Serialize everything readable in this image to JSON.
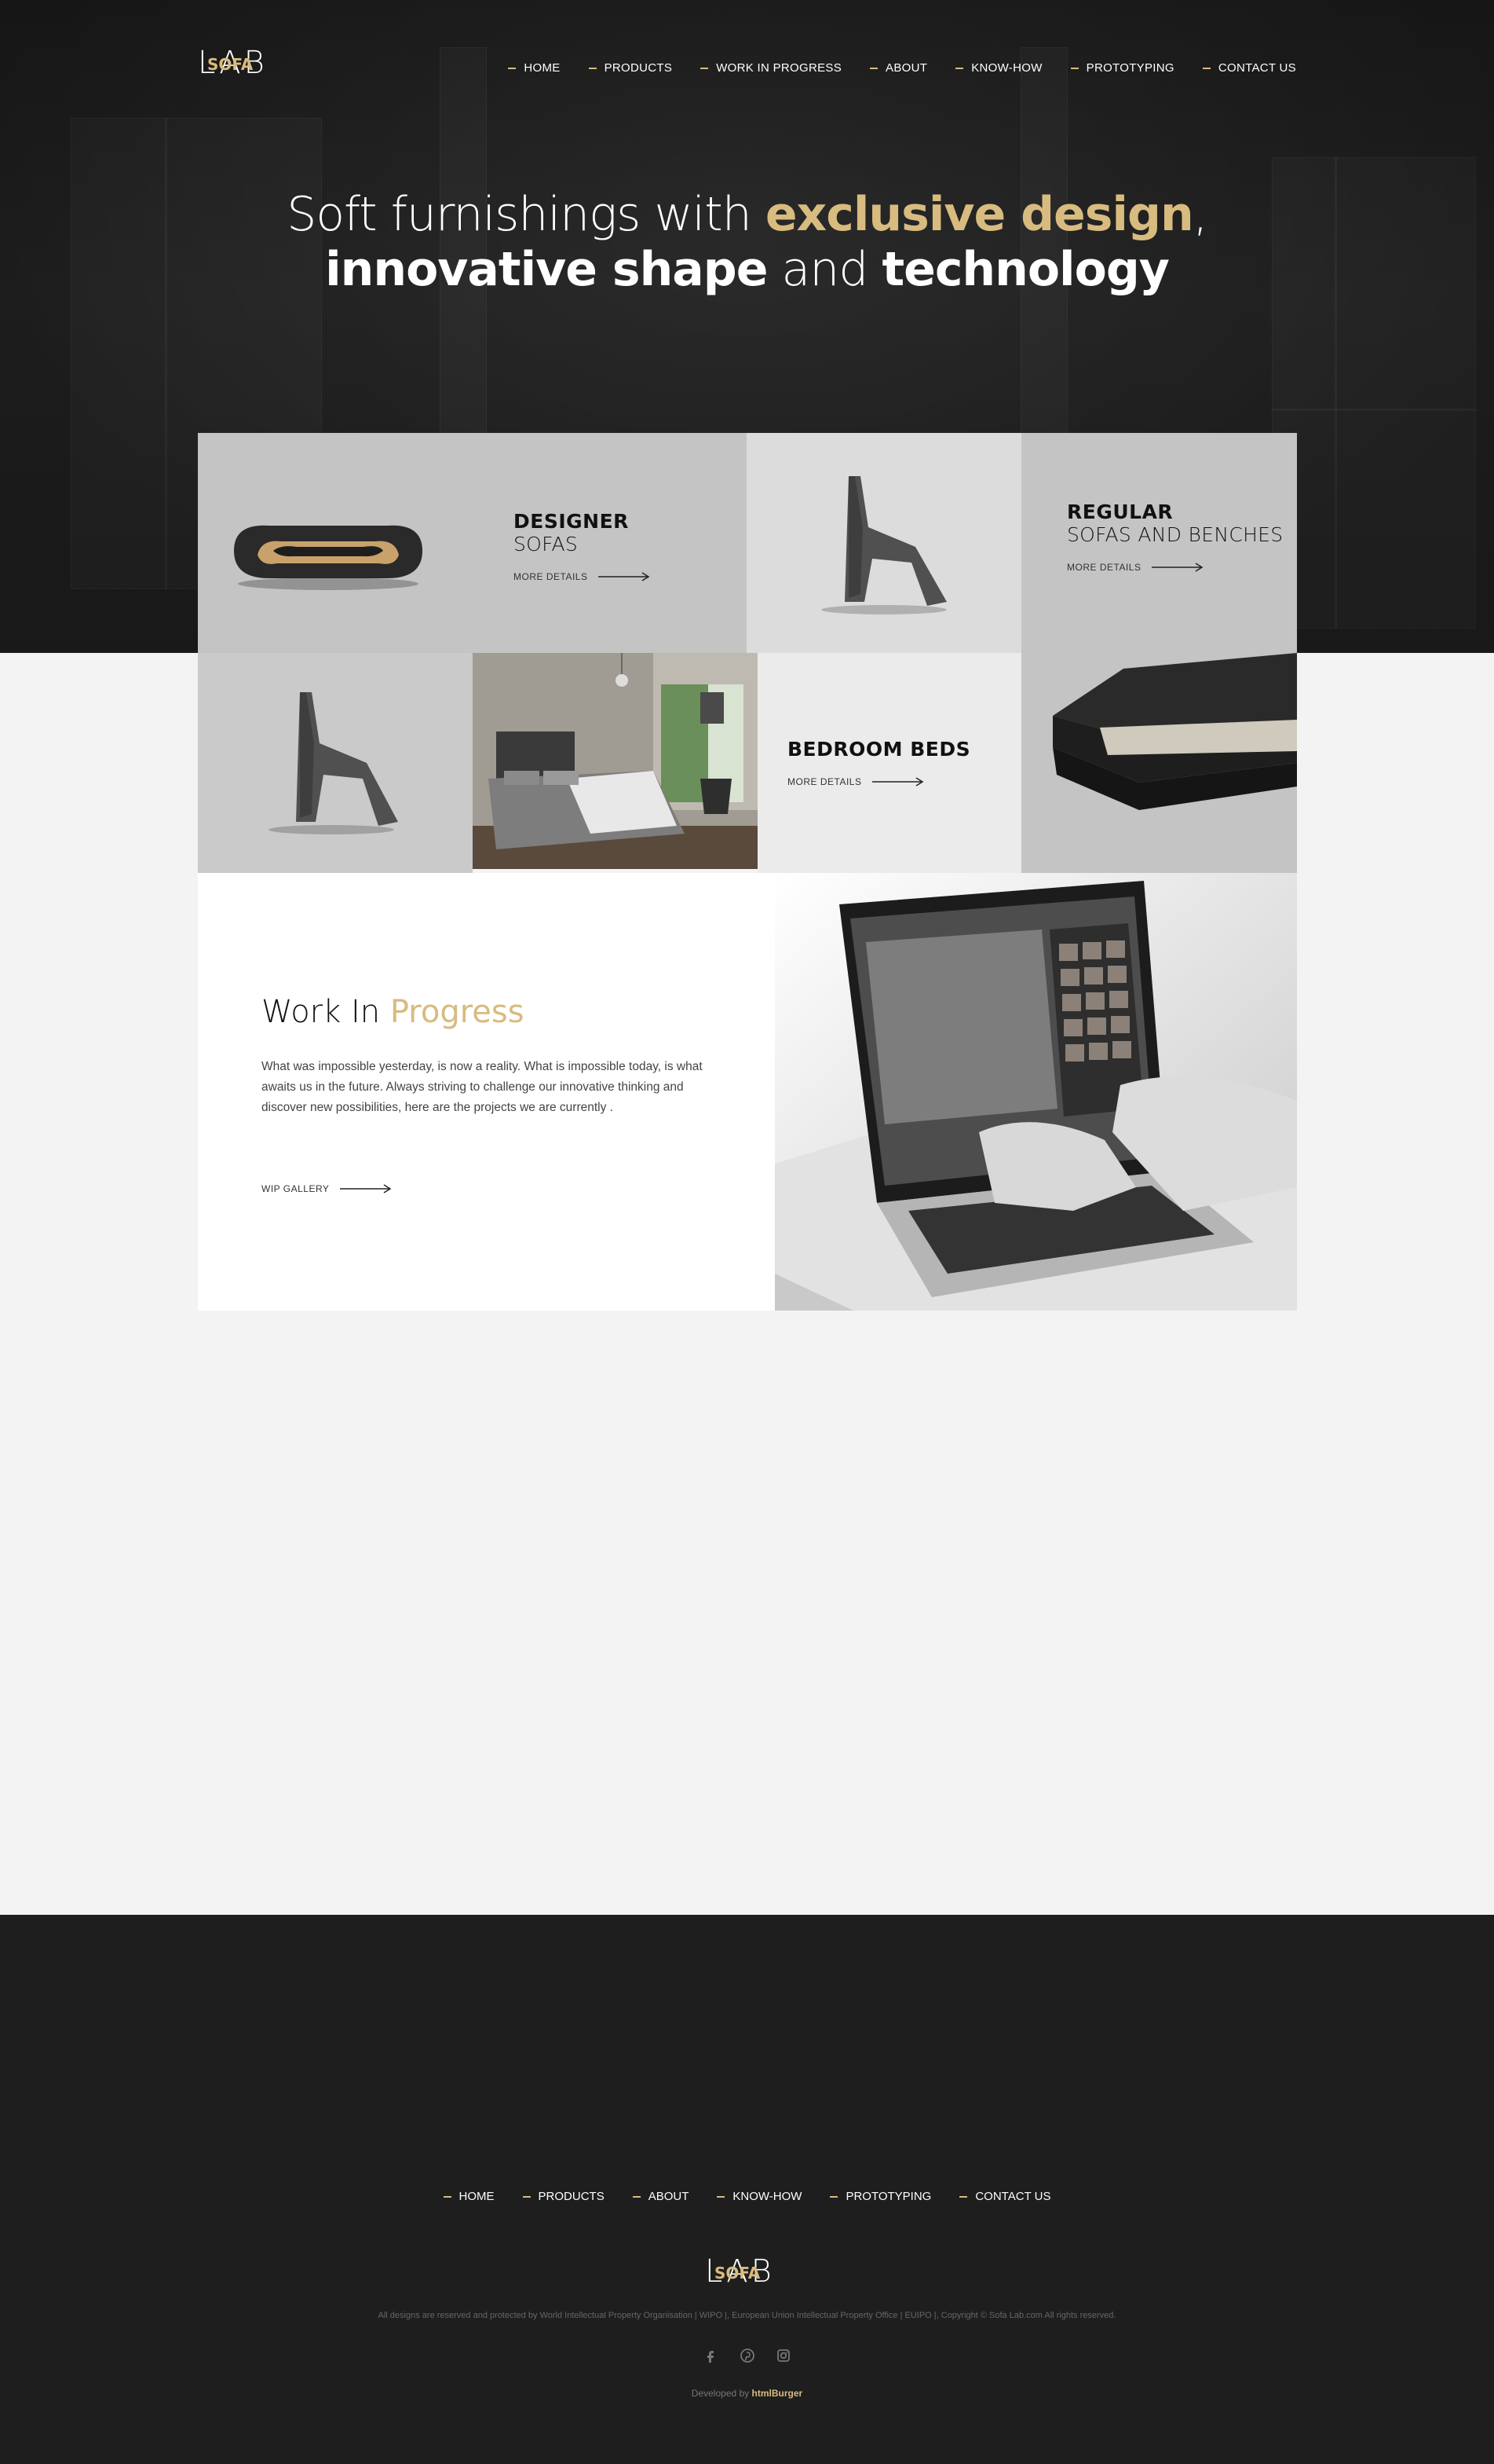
{
  "brand": {
    "logo_main": "LAB",
    "logo_accent": "SOFA"
  },
  "nav": {
    "items": [
      {
        "label": "HOME"
      },
      {
        "label": "PRODUCTS"
      },
      {
        "label": "WORK IN PROGRESS"
      },
      {
        "label": "ABOUT"
      },
      {
        "label": "KNOW-HOW"
      },
      {
        "label": "PROTOTYPING"
      },
      {
        "label": "CONTACT US"
      }
    ]
  },
  "hero": {
    "line1_a": "Soft furnishings with ",
    "line1_gold": "exclusive design",
    "line1_b": ",",
    "line2_a": "innovative shape",
    "line2_b": " and ",
    "line2_c": "technology"
  },
  "tiles": {
    "designer": {
      "title": "DESIGNER",
      "subtitle": "SOFAS",
      "link": "MORE DETAILS"
    },
    "regular": {
      "title": "REGULAR",
      "subtitle": "SOFAS AND BENCHES",
      "link": "MORE DETAILS"
    },
    "bedroom": {
      "title": "BEDROOM BEDS",
      "link": "MORE DETAILS"
    }
  },
  "wip": {
    "title_a": "Work In ",
    "title_gold": "Progress",
    "text": "What was impossible yesterday, is now a reality. What is impossible today, is what awaits us in the future. Always striving to challenge our innovative thinking and discover new possibilities, here are the projects we are currently .",
    "link": "WIP GALLERY"
  },
  "footer": {
    "nav": [
      {
        "label": "HOME"
      },
      {
        "label": "PRODUCTS"
      },
      {
        "label": "ABOUT"
      },
      {
        "label": "KNOW-HOW"
      },
      {
        "label": "PROTOTYPING"
      },
      {
        "label": "CONTACT US"
      }
    ],
    "legal": "All designs are reserved and protected by World Intellectual Property Organisation | WIPO |, European Union Intellectual Property Office | EUIPO |, Copyright © Sofa Lab.com All rights reserved.",
    "social": [
      "facebook-icon",
      "pinterest-icon",
      "instagram-icon"
    ],
    "dev_prefix": "Developed by ",
    "dev_brand": "htmlBurger"
  },
  "colors": {
    "accent": "#d8bb7f",
    "dark": "#1e1e1e",
    "light_bg": "#f3f3f3"
  }
}
